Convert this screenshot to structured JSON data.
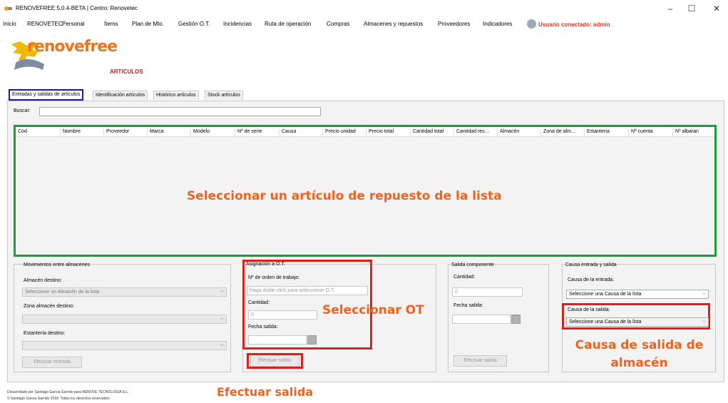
{
  "window": {
    "title": "RENOVEFREE 5.0.4-BETA | Centro: Renovetec",
    "minimize": "–",
    "maximize": "☐",
    "close": "✕"
  },
  "menu": [
    "Inicio",
    "RENOVETEC",
    "Personal",
    "Ítems",
    "Plan de Mto.",
    "Gestión O.T.",
    "Incidencias",
    "Ruta de operación",
    "Compras",
    "Almacenes y repuestos",
    "Proveedores",
    "Indicadores"
  ],
  "user": {
    "label": "Usuario conectado: admin",
    "icon": "user-icon"
  },
  "logo": {
    "text": "renovefree"
  },
  "page_title": "ARTICULOS",
  "tabs": [
    {
      "label": "Entradas y salidas de artículos",
      "active": true
    },
    {
      "label": "Identificación artículos"
    },
    {
      "label": "Histórico artículos"
    },
    {
      "label": "Stock artículos"
    }
  ],
  "search": {
    "label": "Buscar:",
    "value": ""
  },
  "grid": {
    "columns": [
      "Cód",
      "Nombre",
      "Proveedor",
      "Marca",
      "Modelo",
      "Nº de serie",
      "Causa",
      "Precio unidad",
      "Precio total",
      "Cantidad total",
      "Cantidad res…",
      "Almacén",
      "Zona de alm…",
      "Estantería",
      "Nº cuenta",
      "Nº albaran"
    ]
  },
  "annotations": {
    "select_article": "Seleccionar un artículo de repuesto de la lista",
    "select_ot": "Seleccionar OT",
    "exit_cause": "Causa de salida de almacén",
    "do_exit": "Efectuar salida"
  },
  "movements": {
    "title": "Movimientos entre almacenes",
    "dest_label": "Almacén destino:",
    "dest_placeholder": "Seleccione un Almacén de la lista",
    "zone_label": "Zona almacén destino:",
    "shelf_label": "Estantería destino:",
    "button": "Efectuar entrada"
  },
  "ot": {
    "title": "Asignación a O.T.",
    "order_label": "Nº de orden de trabajo:",
    "order_placeholder": "Haga doble click para seleccionar O.T.",
    "qty_label": "Cantidad:",
    "qty_value": "0",
    "date_label": "Fecha salida:",
    "button": "Efectuar salida"
  },
  "component": {
    "title": "Salida componente",
    "qty_label": "Cantidad:",
    "qty_value": "0",
    "date_label": "Fecha salida:",
    "button": "Efectuar salida"
  },
  "cause": {
    "title": "Causa entrada y salida",
    "entry_label": "Causa de la entrada:",
    "entry_value": "Seleccione una Causa de la lista",
    "exit_label": "Causa de la salida:",
    "exit_value": "Seleccione una Causa de la lista"
  },
  "footer": {
    "line1": "Desarrollado por Santiago García Garrido para RENOVE TECNOLOGIA S.L.",
    "line2": "© Santiago García Garrido 2018. Todos los derechos reservados."
  },
  "colors": {
    "accent_orange": "#f0621e",
    "highlight_red": "#e01e1e",
    "highlight_green": "#1d9b3a",
    "highlight_blue": "#1515c8",
    "user_red": "#e03020"
  }
}
